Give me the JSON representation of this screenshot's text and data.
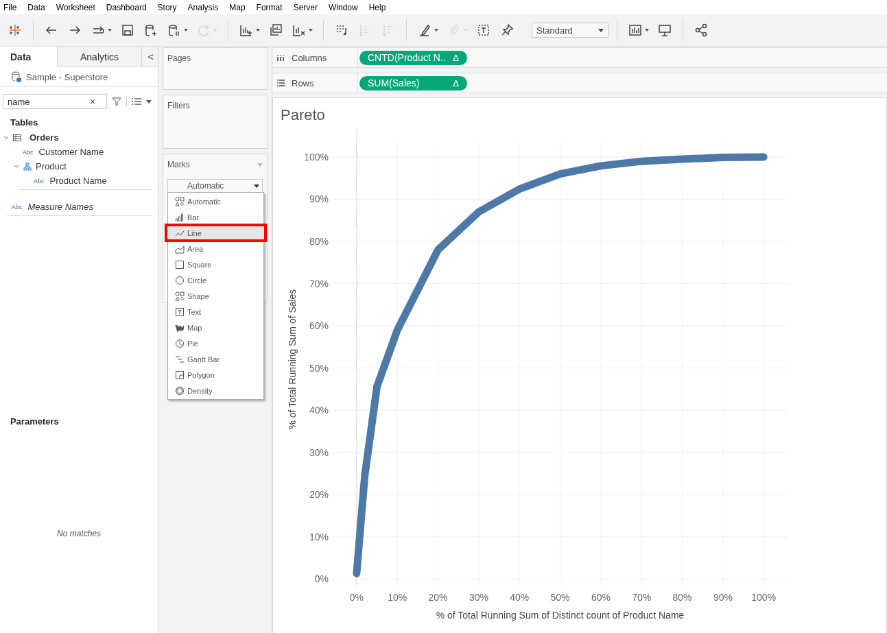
{
  "menu": [
    "File",
    "Data",
    "Worksheet",
    "Dashboard",
    "Story",
    "Analysis",
    "Map",
    "Format",
    "Server",
    "Window",
    "Help"
  ],
  "toolbar": [
    {
      "kind": "logo",
      "disabled": false,
      "dropdown": false
    },
    {
      "kind": "separator"
    },
    {
      "kind": "back",
      "disabled": false,
      "dropdown": false
    },
    {
      "kind": "forward",
      "disabled": false,
      "dropdown": false
    },
    {
      "kind": "replay",
      "disabled": false,
      "dropdown": true
    },
    {
      "kind": "save",
      "disabled": false,
      "dropdown": false
    },
    {
      "kind": "add-datasource",
      "disabled": false,
      "dropdown": false
    },
    {
      "kind": "pause",
      "disabled": false,
      "dropdown": true
    },
    {
      "kind": "refresh",
      "disabled": true,
      "dropdown": true
    },
    {
      "kind": "separator"
    },
    {
      "kind": "new-sheet",
      "disabled": false,
      "dropdown": true
    },
    {
      "kind": "duplicate-sheet",
      "disabled": false,
      "dropdown": false
    },
    {
      "kind": "clear-sheet",
      "disabled": false,
      "dropdown": true
    },
    {
      "kind": "separator"
    },
    {
      "kind": "swap",
      "disabled": false,
      "dropdown": false
    },
    {
      "kind": "sort-asc",
      "disabled": true,
      "dropdown": false
    },
    {
      "kind": "sort-desc",
      "disabled": true,
      "dropdown": false
    },
    {
      "kind": "separator"
    },
    {
      "kind": "highlight",
      "disabled": false,
      "dropdown": true
    },
    {
      "kind": "paperclip",
      "disabled": true,
      "dropdown": true
    },
    {
      "kind": "text-label",
      "disabled": false,
      "dropdown": false
    },
    {
      "kind": "pin",
      "disabled": false,
      "dropdown": false
    },
    {
      "kind": "fit",
      "value": "Standard"
    },
    {
      "kind": "separator"
    },
    {
      "kind": "show-me",
      "disabled": false,
      "dropdown": true
    },
    {
      "kind": "presentation",
      "disabled": false,
      "dropdown": false
    },
    {
      "kind": "separator"
    },
    {
      "kind": "share",
      "disabled": false,
      "dropdown": false
    }
  ],
  "left_panel": {
    "tabs": [
      {
        "label": "Data",
        "selected": true
      },
      {
        "label": "Analytics",
        "selected": false
      }
    ],
    "collapse": "<",
    "datasource": "Sample - Superstore",
    "search": {
      "value": "name",
      "clear": "×"
    },
    "tables_heading": "Tables",
    "tree": [
      {
        "label": "Orders",
        "kind": "table",
        "expanded": true,
        "children": [
          {
            "label": "Customer Name",
            "kind": "dimension",
            "type": "Abc"
          },
          {
            "label": "Product",
            "kind": "hierarchy",
            "expanded": true,
            "children": [
              {
                "label": "Product Name",
                "kind": "dimension",
                "type": "Abc"
              }
            ]
          }
        ]
      }
    ],
    "extra_fields": [
      {
        "label": "Measure Names",
        "type": "Abc"
      }
    ],
    "parameters_heading": "Parameters",
    "parameters_empty": "No matches"
  },
  "cards": {
    "pages": "Pages",
    "filters": "Filters",
    "marks": "Marks",
    "mark_type": "Automatic"
  },
  "mark_menu": [
    {
      "label": "Automatic",
      "kind": "automatic",
      "selected": false
    },
    {
      "label": "Bar",
      "kind": "bar",
      "selected": false
    },
    {
      "label": "Line",
      "kind": "line",
      "selected": true
    },
    {
      "label": "Area",
      "kind": "area",
      "selected": false
    },
    {
      "label": "Square",
      "kind": "square",
      "selected": false
    },
    {
      "label": "Circle",
      "kind": "circle",
      "selected": false
    },
    {
      "label": "Shape",
      "kind": "shape",
      "selected": false
    },
    {
      "label": "Text",
      "kind": "text",
      "selected": false
    },
    {
      "label": "Map",
      "kind": "map",
      "selected": false
    },
    {
      "label": "Pie",
      "kind": "pie",
      "selected": false
    },
    {
      "label": "Gantt Bar",
      "kind": "gantt",
      "selected": false
    },
    {
      "label": "Polygon",
      "kind": "polygon",
      "selected": false
    },
    {
      "label": "Density",
      "kind": "density",
      "selected": false
    }
  ],
  "shelves": [
    {
      "label": "Columns",
      "kind": "columns",
      "pill": "CNTD(Product N..",
      "delta": "Δ"
    },
    {
      "label": "Rows",
      "kind": "rows",
      "pill": "SUM(Sales)",
      "delta": "Δ"
    }
  ],
  "view": {
    "title": "Pareto",
    "chart_data": {
      "type": "line",
      "xlabel": "% of Total Running Sum of Distinct count of Product Name",
      "ylabel": "% of Total Running Sum of Sales",
      "x": [
        0,
        0.02,
        0.05,
        0.1,
        0.2,
        0.3,
        0.4,
        0.5,
        0.6,
        0.7,
        0.8,
        0.9,
        1
      ],
      "grid": true,
      "series": [
        {
          "color": "#4e79a7",
          "values": [
            0.013,
            0.245,
            0.456,
            0.59,
            0.78,
            0.87,
            0.924,
            0.96,
            0.979,
            0.99,
            0.995,
            0.999,
            1
          ]
        }
      ],
      "xlim": [
        0,
        1
      ],
      "ylim": [
        0,
        1
      ],
      "xticks": [
        {
          "value": 0,
          "label": "0%"
        },
        {
          "value": 0.1,
          "label": "10%"
        },
        {
          "value": 0.2,
          "label": "20%"
        },
        {
          "value": 0.3,
          "label": "30%"
        },
        {
          "value": 0.4,
          "label": "40%"
        },
        {
          "value": 0.5,
          "label": "50%"
        },
        {
          "value": 0.6,
          "label": "60%"
        },
        {
          "value": 0.7,
          "label": "70%"
        },
        {
          "value": 0.8,
          "label": "80%"
        },
        {
          "value": 0.9,
          "label": "90%"
        },
        {
          "value": 1,
          "label": "100%"
        }
      ],
      "yticks": [
        {
          "value": 0,
          "label": "0%"
        },
        {
          "value": 0.1,
          "label": "10%"
        },
        {
          "value": 0.2,
          "label": "20%"
        },
        {
          "value": 0.3,
          "label": "30%"
        },
        {
          "value": 0.4,
          "label": "40%"
        },
        {
          "value": 0.5,
          "label": "50%"
        },
        {
          "value": 0.6,
          "label": "60%"
        },
        {
          "value": 0.7,
          "label": "70%"
        },
        {
          "value": 0.8,
          "label": "80%"
        },
        {
          "value": 0.9,
          "label": "90%"
        },
        {
          "value": 1,
          "label": "100%"
        }
      ]
    }
  }
}
